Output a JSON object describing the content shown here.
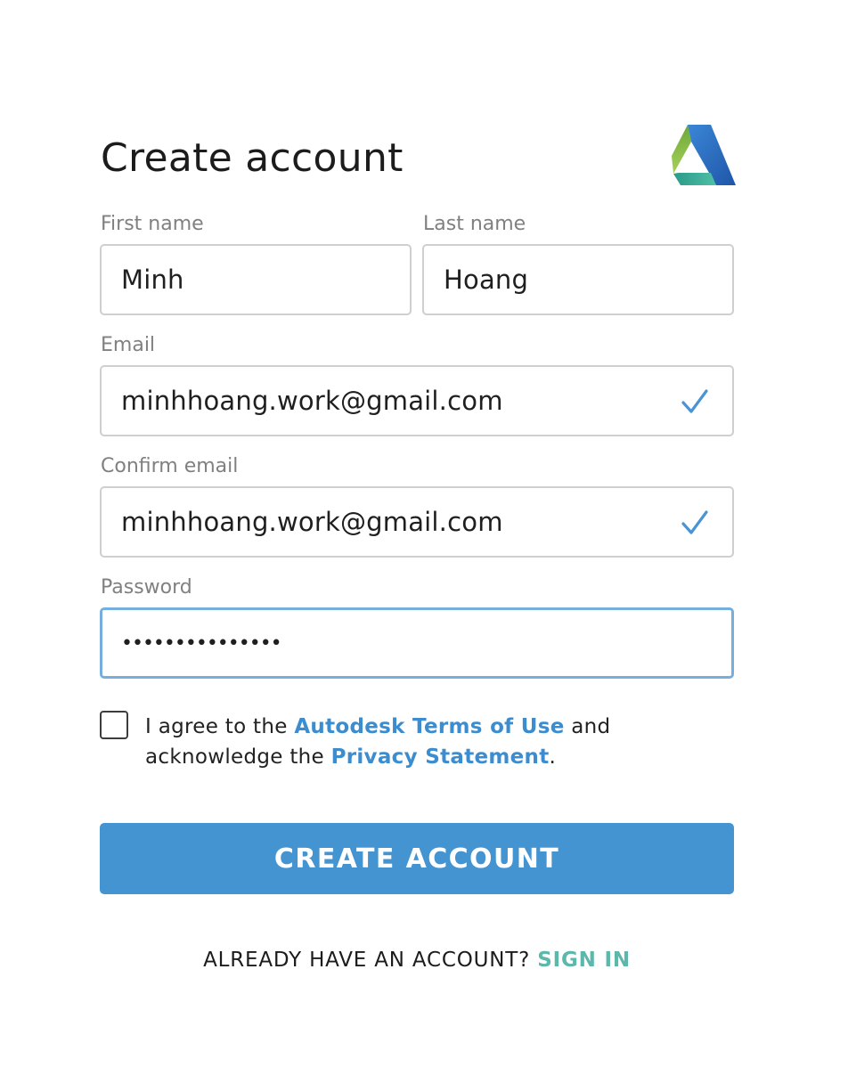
{
  "page": {
    "title": "Create account"
  },
  "brand": {
    "logo": "autodesk-logo",
    "colors": [
      "#8dbf3e",
      "#3aa9a0",
      "#2c6fc0",
      "#1e4fa6"
    ]
  },
  "form": {
    "first_name": {
      "label": "First name",
      "value": "Minh"
    },
    "last_name": {
      "label": "Last name",
      "value": "Hoang"
    },
    "email": {
      "label": "Email",
      "value": "minhhoang.work@gmail.com",
      "valid_icon": "check-icon"
    },
    "confirm_email": {
      "label": "Confirm email",
      "value": "minhhoang.work@gmail.com",
      "valid_icon": "check-icon"
    },
    "password": {
      "label": "Password",
      "masked_value": "•••••••••••••••"
    }
  },
  "agreement": {
    "checked": false,
    "prefix": "I agree to the ",
    "terms_link": "Autodesk Terms of Use",
    "middle": " and acknowledge the ",
    "privacy_link": "Privacy Statement",
    "suffix": "."
  },
  "actions": {
    "create_label": "CREATE ACCOUNT"
  },
  "footer": {
    "prompt": "ALREADY HAVE AN ACCOUNT? ",
    "signin_label": "SIGN IN"
  },
  "colors": {
    "accent": "#4494d2",
    "link": "#3c8dd0",
    "signin": "#5bb8ab",
    "focus_border": "#76aee0",
    "check": "#4a94d4"
  }
}
